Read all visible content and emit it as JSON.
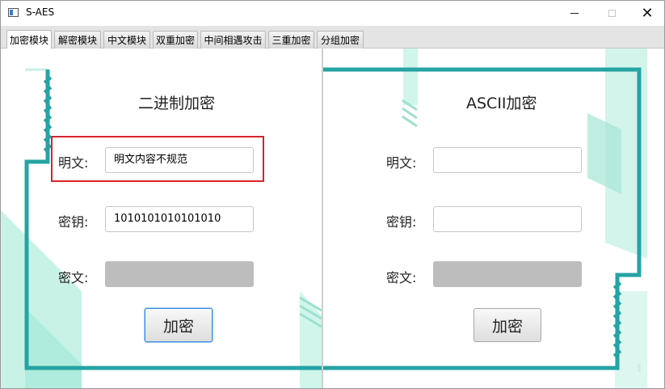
{
  "window": {
    "title": "S-AES",
    "close_glyph": "✕"
  },
  "tabs": [
    {
      "label": "加密模块",
      "active": true
    },
    {
      "label": "解密模块",
      "active": false
    },
    {
      "label": "中文模块",
      "active": false
    },
    {
      "label": "双重加密",
      "active": false
    },
    {
      "label": "中间相遇攻击",
      "active": false
    },
    {
      "label": "三重加密",
      "active": false
    },
    {
      "label": "分组加密",
      "active": false
    }
  ],
  "binary": {
    "heading": "二进制加密",
    "plaintext_label": "明文:",
    "plaintext_value": "明文内容不规范",
    "key_label": "密钥:",
    "key_value": "1010101010101010",
    "ciphertext_label": "密文:",
    "ciphertext_value": "",
    "encrypt_label": "加密"
  },
  "ascii": {
    "heading": "ASCII加密",
    "plaintext_label": "明文:",
    "plaintext_value": "",
    "key_label": "密钥:",
    "key_value": "",
    "ciphertext_label": "密文:",
    "ciphertext_value": "",
    "encrypt_label": "加密"
  },
  "colors": {
    "teal_border": "#26a3a3",
    "mint_accent": "#b8f0e3",
    "highlight": "#d8232a"
  }
}
